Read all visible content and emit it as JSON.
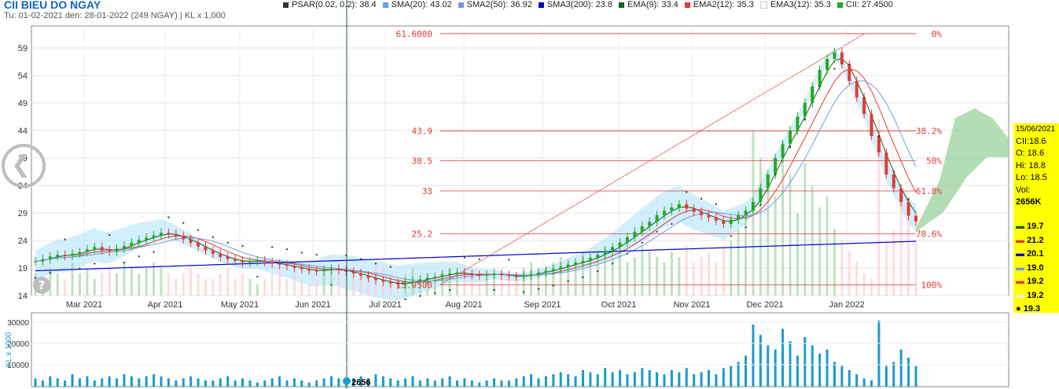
{
  "header": {
    "title": "CII BIEU DO NGAY",
    "subtitle": "Tu: 01-02-2021 den: 28-01-2022 (249 NGAY) | KL x 1,000"
  },
  "legend": [
    {
      "label": "PSAR(0.02, 0.2): 38.4",
      "color": "#333333"
    },
    {
      "label": "SMA(20): 43.02",
      "color": "#6a9ef0"
    },
    {
      "label": "SMA2(50): 36.92",
      "color": "#7a8ee8"
    },
    {
      "label": "SMA3(200): 23.8",
      "color": "#0000cc"
    },
    {
      "label": "EMA(9): 33.4",
      "color": "#1b5e20"
    },
    {
      "label": "EMA2(12): 35.3",
      "color": "#e53935"
    },
    {
      "label": "EMA3(12): 35.3",
      "color": "#ffffff"
    },
    {
      "label": "CII: 27.4500",
      "color": "#22aa22"
    }
  ],
  "info_box": {
    "date": "15/06/2021",
    "symbol": "CII:18.6",
    "open": "O: 18.6",
    "high": "Hi: 18.8",
    "low": "Lo: 18.5",
    "vol_label": "Vol:",
    "vol_value": "2656K"
  },
  "indicator_values": [
    {
      "text": "19.7",
      "color": "#1b5e20"
    },
    {
      "text": "21.2",
      "color": "#e53935"
    },
    {
      "text": "20.1",
      "color": "#0000cc"
    },
    {
      "text": "19.0",
      "color": "#6a9ef0"
    },
    {
      "text": "19.2",
      "color": "#e53935"
    },
    {
      "text": "19.2",
      "color": "#eeeeee"
    },
    {
      "text": "19.3",
      "color": "#000000"
    }
  ],
  "volume_marker": "2656",
  "colors": {
    "up": "#22aa22",
    "down": "#e53935",
    "fib": "#e53935"
  },
  "chart_data": {
    "type": "candlestick",
    "title": "CII BIEU DO NGAY",
    "x_tick_labels": [
      "Mar 2021",
      "Apr 2021",
      "May 2021",
      "Jun 2021",
      "Jul 2021",
      "Aug 2021",
      "Sep 2021",
      "Oct 2021",
      "Nov 2021",
      "Dec 2021",
      "Jan 2022"
    ],
    "y_tick_labels": [
      "14",
      "19",
      "24",
      "29",
      "34",
      "39",
      "44",
      "49",
      "54",
      "59"
    ],
    "ylim": [
      14,
      63
    ],
    "volume_axis": {
      "label": "KL x 1000",
      "ticks": [
        "30000",
        "20000",
        "10000"
      ]
    },
    "fibonacci": [
      {
        "price": "61.6000",
        "pct": "0%"
      },
      {
        "price": "43.9",
        "pct": "38.2%"
      },
      {
        "price": "38.5",
        "pct": "50%"
      },
      {
        "price": "33",
        "pct": "61.8%"
      },
      {
        "price": "25.2",
        "pct": "78.6%"
      },
      {
        "price": "15.9500",
        "pct": "100%"
      }
    ],
    "close": [
      20.2,
      20.6,
      21.1,
      21.4,
      21.2,
      21.6,
      21.9,
      22.4,
      22.8,
      22.2,
      22.0,
      22.5,
      23.0,
      23.6,
      24.1,
      24.5,
      24.9,
      25.4,
      25.2,
      24.8,
      24.2,
      23.6,
      22.9,
      22.2,
      21.6,
      21.0,
      20.6,
      20.3,
      20.0,
      20.2,
      20.4,
      20.1,
      19.8,
      19.6,
      19.4,
      19.0,
      18.8,
      18.5,
      18.4,
      18.7,
      18.9,
      18.6,
      18.3,
      18.0,
      17.6,
      17.2,
      16.8,
      16.5,
      16.2,
      16.0,
      16.3,
      16.6,
      16.9,
      17.2,
      17.4,
      17.8,
      18.0,
      18.2,
      17.9,
      17.7,
      17.6,
      17.8,
      18.0,
      17.7,
      17.5,
      17.4,
      17.6,
      17.9,
      18.2,
      18.5,
      18.8,
      19.2,
      19.6,
      20.0,
      20.3,
      20.8,
      21.4,
      22.0,
      22.8,
      23.6,
      24.6,
      25.6,
      26.6,
      27.4,
      28.6,
      29.4,
      30.0,
      30.6,
      29.8,
      29.2,
      28.6,
      28.2,
      27.6,
      27.0,
      27.8,
      28.6,
      29.4,
      31.0,
      33.5,
      36.0,
      39.0,
      41.5,
      44.0,
      46.5,
      49.0,
      52.0,
      55.0,
      57.0,
      58.2,
      56.0,
      53.0,
      50.0,
      47.0,
      43.0,
      40.0,
      36.0,
      33.5,
      31.0,
      28.5,
      27.45
    ],
    "volume": [
      4,
      3,
      5,
      4,
      3,
      6,
      4,
      5,
      3,
      4,
      5,
      4,
      6,
      5,
      4,
      5,
      6,
      5,
      4,
      3,
      4,
      5,
      4,
      3,
      3,
      4,
      5,
      3,
      4,
      3,
      2,
      3,
      4,
      5,
      3,
      4,
      3,
      2,
      3,
      4,
      5,
      4,
      3,
      4,
      5,
      4,
      6,
      5,
      4,
      3,
      4,
      5,
      3,
      4,
      3,
      4,
      5,
      3,
      4,
      3,
      2,
      3,
      4,
      3,
      3,
      4,
      5,
      6,
      4,
      5,
      6,
      7,
      6,
      5,
      8,
      7,
      6,
      9,
      7,
      8,
      6,
      7,
      9,
      8,
      7,
      6,
      8,
      7,
      9,
      6,
      7,
      8,
      6,
      9,
      10,
      12,
      15,
      30,
      25,
      20,
      18,
      28,
      22,
      15,
      24,
      20,
      16,
      18,
      12,
      10,
      8,
      6,
      4,
      3,
      32,
      10,
      12,
      18,
      14,
      10
    ]
  }
}
